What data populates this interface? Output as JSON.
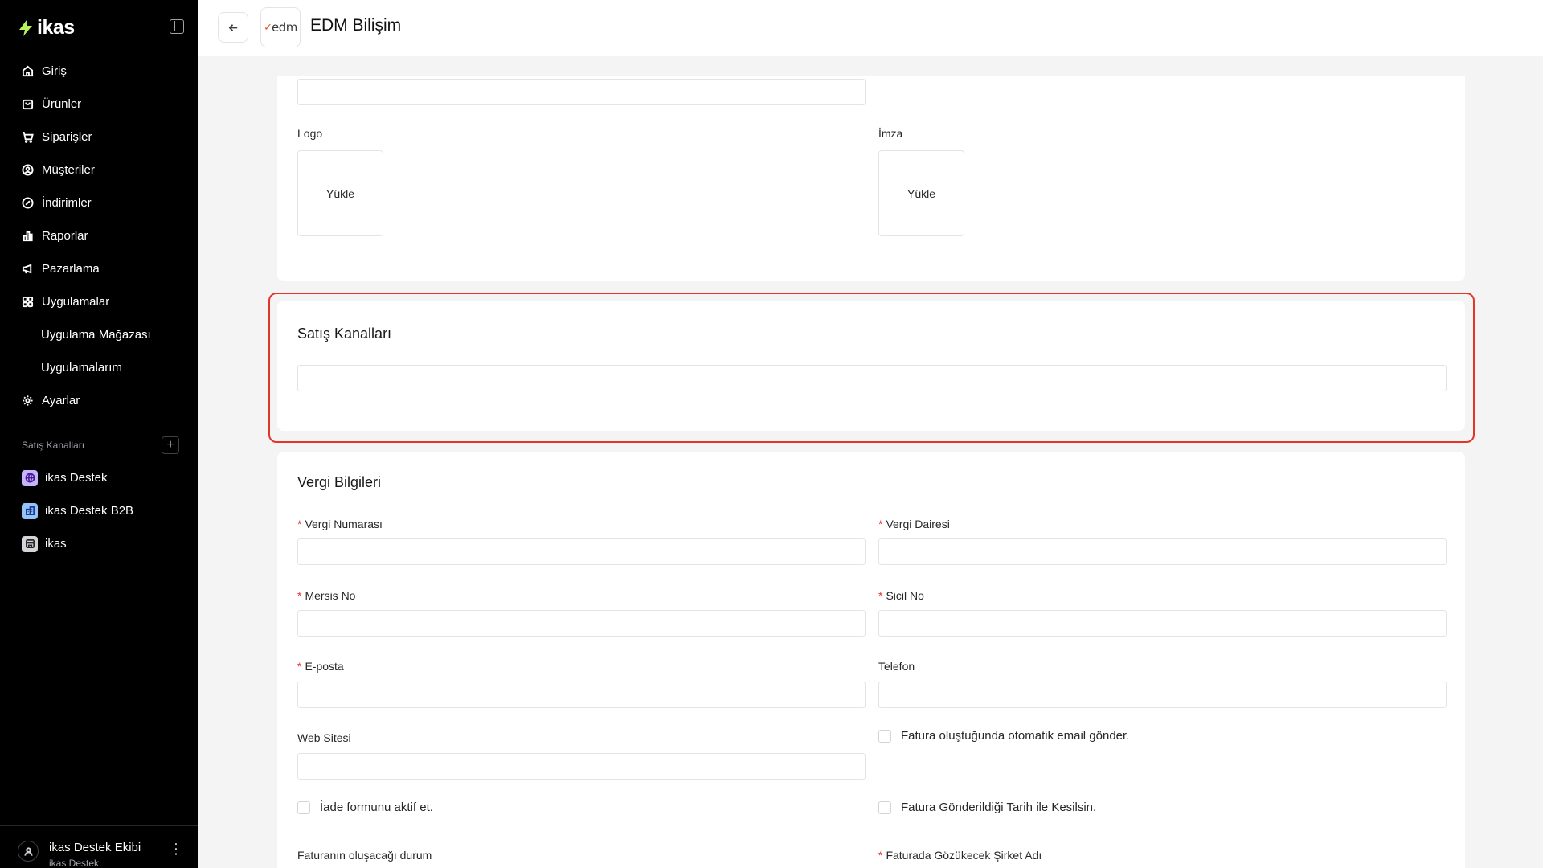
{
  "brand": {
    "name": "ikas",
    "accent": "#b6f35c"
  },
  "sidebar": {
    "items": [
      {
        "label": "Giriş",
        "icon": "home-icon"
      },
      {
        "label": "Ürünler",
        "icon": "box-icon"
      },
      {
        "label": "Siparişler",
        "icon": "cart-icon"
      },
      {
        "label": "Müşteriler",
        "icon": "user-circle-icon"
      },
      {
        "label": "İndirimler",
        "icon": "discount-icon"
      },
      {
        "label": "Raporlar",
        "icon": "bar-chart-icon"
      },
      {
        "label": "Pazarlama",
        "icon": "megaphone-icon"
      },
      {
        "label": "Uygulamalar",
        "icon": "grid-icon"
      },
      {
        "label": "Uygulama Mağazası",
        "icon": ""
      },
      {
        "label": "Uygulamalarım",
        "icon": ""
      },
      {
        "label": "Ayarlar",
        "icon": "gear-icon"
      }
    ],
    "channels_heading": "Satış Kanalları",
    "add_symbol": "+",
    "channels": [
      {
        "label": "ikas Destek",
        "icon": "globe-icon",
        "color": "#c4b5fd"
      },
      {
        "label": "ikas Destek B2B",
        "icon": "building-icon",
        "color": "#93c5fd"
      },
      {
        "label": "ikas",
        "icon": "store-icon",
        "color": "#d4d4d8"
      }
    ],
    "user": {
      "name": "ikas Destek Ekibi",
      "store": "ikas Destek",
      "menu": "⋮"
    }
  },
  "header": {
    "title": "EDM Bilişim",
    "logo_text": "edm",
    "logo_check": "✓"
  },
  "section_top": {
    "logo_label": "Logo",
    "signature_label": "İmza",
    "upload_label": "Yükle"
  },
  "sales_channels": {
    "title": "Satış Kanalları"
  },
  "tax": {
    "title": "Vergi Bilgileri",
    "tax_number": "Vergi Numarası",
    "tax_office": "Vergi Dairesi",
    "mersis": "Mersis No",
    "registry": "Sicil No",
    "email": "E-posta",
    "phone": "Telefon",
    "website": "Web Sitesi",
    "auto_email": "Fatura oluştuğunda otomatik email gönder.",
    "return_form": "İade formunu aktif et.",
    "send_date": "Fatura Gönderildiği Tarih ile Kesilsin.",
    "invoice_status": "Faturanın oluşacağı durum",
    "company_name": "Faturada Gözükecek Şirket Adı",
    "required_mark": "*"
  },
  "colors": {
    "highlight": "#e5352b",
    "sidebar_bg": "#000000",
    "page_bg": "#f4f4f5"
  }
}
